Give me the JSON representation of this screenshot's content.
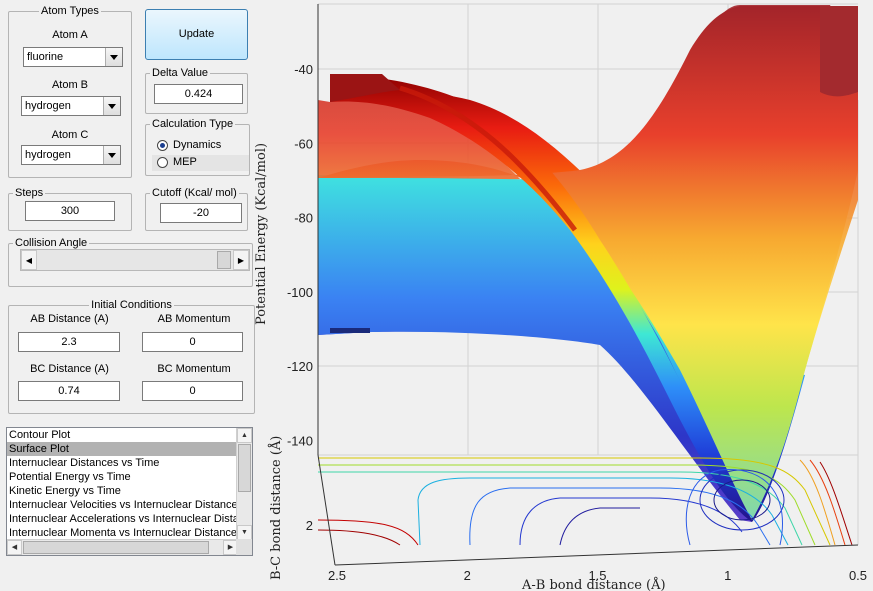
{
  "atom_types": {
    "legend": "Atom Types",
    "atom_a": {
      "label": "Atom A",
      "value": "fluorine"
    },
    "atom_b": {
      "label": "Atom B",
      "value": "hydrogen"
    },
    "atom_c": {
      "label": "Atom C",
      "value": "hydrogen"
    }
  },
  "update_button": "Update",
  "delta": {
    "legend": "Delta Value",
    "value": "0.424"
  },
  "calc_type": {
    "legend": "Calculation Type",
    "options": [
      "Dynamics",
      "MEP"
    ],
    "selected": "Dynamics"
  },
  "steps": {
    "legend": "Steps",
    "value": "300"
  },
  "cutoff": {
    "legend": "Cutoff (Kcal/ mol)",
    "value": "-20"
  },
  "collision_angle": {
    "legend": "Collision Angle"
  },
  "initial_conditions": {
    "legend": "Initial Conditions",
    "ab_distance": {
      "label": "AB Distance (A)",
      "value": "2.3"
    },
    "ab_momentum": {
      "label": "AB Momentum",
      "value": "0"
    },
    "bc_distance": {
      "label": "BC Distance (A)",
      "value": "0.74"
    },
    "bc_momentum": {
      "label": "BC Momentum",
      "value": "0"
    }
  },
  "plot_list": {
    "items": [
      "Contour Plot",
      "Surface Plot",
      "Internuclear Distances vs Time",
      "Potential Energy vs Time",
      "Kinetic Energy vs Time",
      "Internuclear Velocities vs Internuclear Distance",
      "Internuclear Accelerations vs Internuclear Distance",
      "Internuclear Momenta vs Internuclear Distance"
    ],
    "selected_index": 1
  },
  "colors": {
    "selection": "#b2b2b2",
    "button_border": "#3c7fb1"
  },
  "chart_data": {
    "type": "surface",
    "zlabel": "Potential Energy (Kcal/mol)",
    "xlabel": "A-B bond distance (Å)",
    "ylabel": "B-C bond distance (Å)",
    "z_ticks": [
      -40,
      -60,
      -80,
      -100,
      -120,
      -140
    ],
    "x_ticks": [
      "2.5",
      "2",
      "1.5",
      "1",
      "0.5"
    ],
    "y_ticks": [
      "2"
    ],
    "zlim": [
      -145,
      -35
    ],
    "xlim": [
      2.55,
      0.5
    ],
    "grid": true,
    "colormap": "jet"
  }
}
